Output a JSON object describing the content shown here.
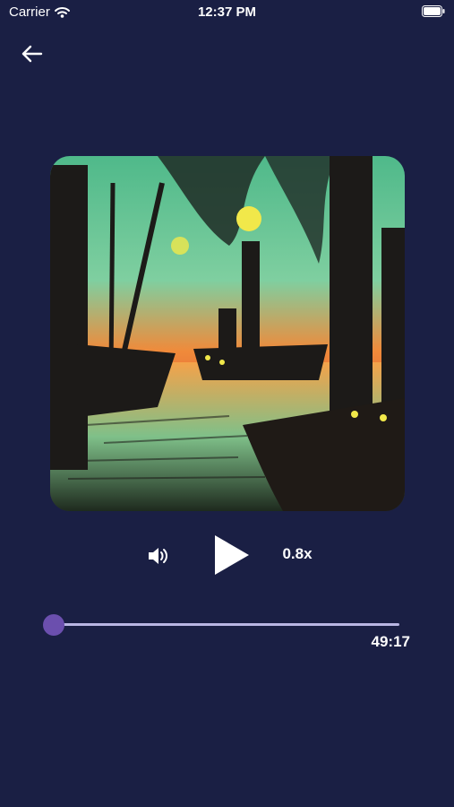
{
  "status_bar": {
    "carrier": "Carrier",
    "time": "12:37 PM"
  },
  "player": {
    "speed_label": "0.8x",
    "duration_label": "49:17",
    "progress_fraction": 0.0
  },
  "colors": {
    "background": "#1a1f44",
    "thumb": "#6b4fae",
    "track": "#b9b6e3"
  },
  "icons": {
    "back": "arrow-left-icon",
    "volume": "volume-icon",
    "play": "play-icon",
    "wifi": "wifi-icon",
    "battery": "battery-icon"
  }
}
